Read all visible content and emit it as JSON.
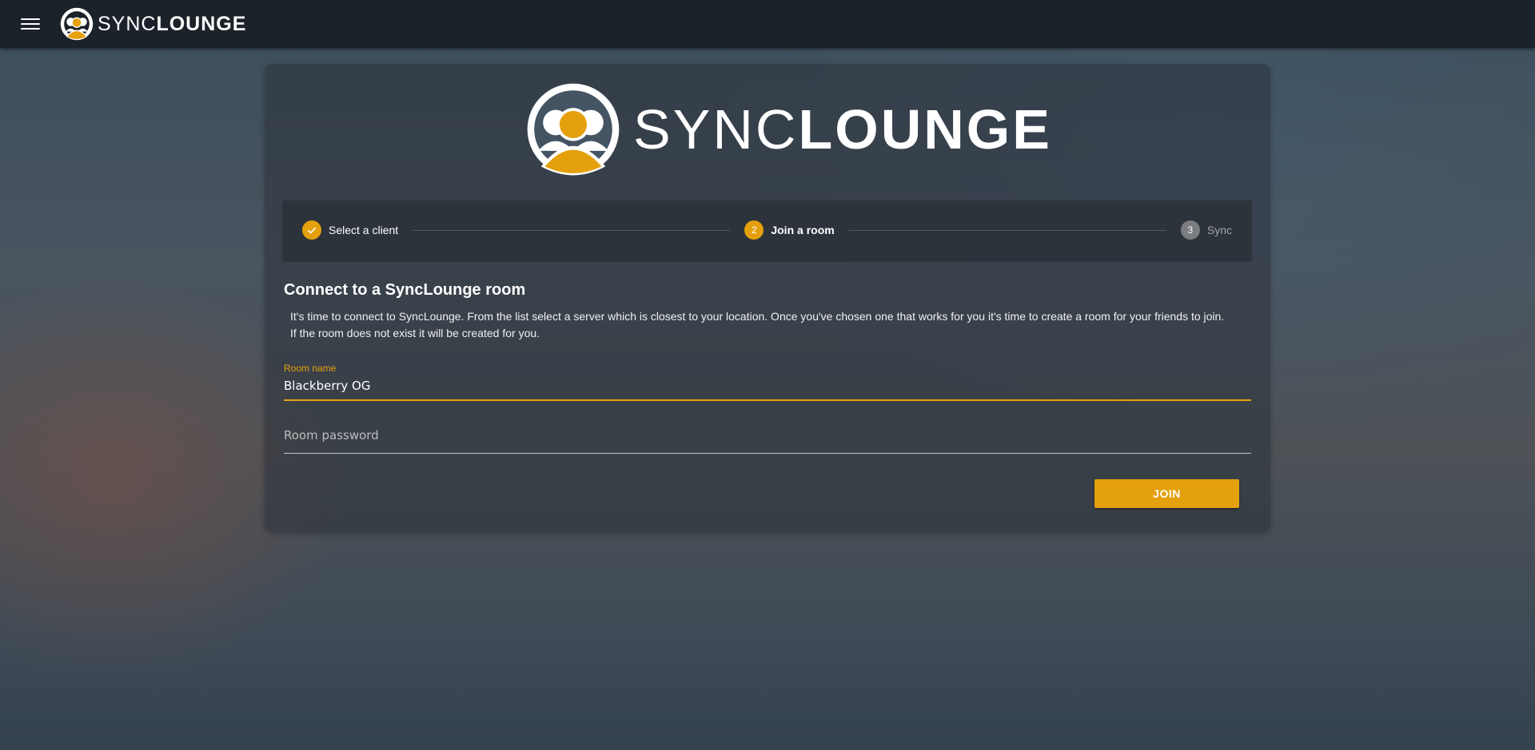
{
  "appbar": {
    "brand_light": "SYNC",
    "brand_bold": "LOUNGE"
  },
  "hero": {
    "brand_light": "SYNC",
    "brand_bold": "LOUNGE"
  },
  "stepper": {
    "steps": [
      {
        "number": "",
        "label": "Select a client",
        "state": "completed"
      },
      {
        "number": "2",
        "label": "Join a room",
        "state": "active"
      },
      {
        "number": "3",
        "label": "Sync",
        "state": "inactive"
      }
    ]
  },
  "main": {
    "title": "Connect to a SyncLounge room",
    "description_line1": "It's time to connect to SyncLounge. From the list select a server which is closest to your location. Once you've chosen one that works for you it's time to create a room for your friends to join.",
    "description_line2": "If the room does not exist it will be created for you."
  },
  "form": {
    "room_name_label": "Room name",
    "room_name_value": "Blackberry OG",
    "room_password_placeholder": "Room password",
    "room_password_value": "",
    "join_label": "JOIN"
  },
  "colors": {
    "accent": "#e5a00d",
    "appbar": "#1c222a",
    "stepper_bg": "#2d333a"
  },
  "icons": [
    "menu-icon",
    "synclounge-logo-icon",
    "check-icon"
  ]
}
